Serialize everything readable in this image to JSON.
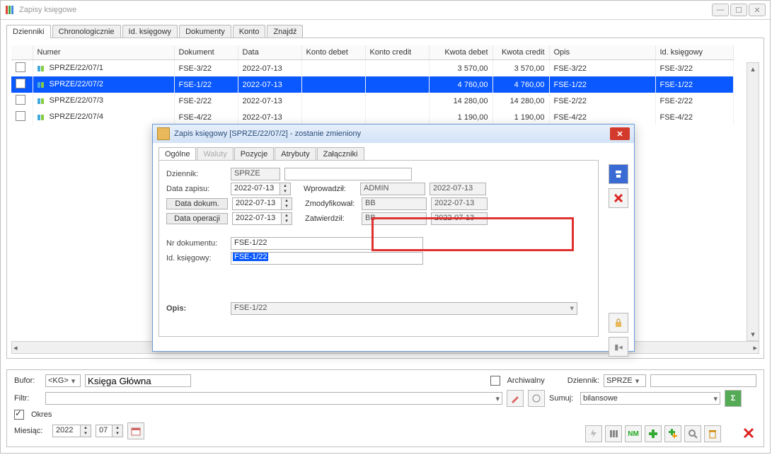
{
  "window": {
    "title": "Zapisy księgowe"
  },
  "tabs": [
    "Dzienniki",
    "Chronologicznie",
    "Id. księgowy",
    "Dokumenty",
    "Konto",
    "Znajdź"
  ],
  "grid": {
    "headers": [
      "Numer",
      "Dokument",
      "Data",
      "Konto debet",
      "Konto credit",
      "Kwota debet",
      "Kwota credit",
      "Opis",
      "Id. księgowy"
    ],
    "rows": [
      {
        "numer": "SPRZE/22/07/1",
        "dokument": "FSE-3/22",
        "data": "2022-07-13",
        "kdebet": "",
        "kcredit": "",
        "kwd": "3 570,00",
        "kwc": "3 570,00",
        "opis": "FSE-3/22",
        "idk": "FSE-3/22"
      },
      {
        "numer": "SPRZE/22/07/2",
        "dokument": "FSE-1/22",
        "data": "2022-07-13",
        "kdebet": "",
        "kcredit": "",
        "kwd": "4 760,00",
        "kwc": "4 760,00",
        "opis": "FSE-1/22",
        "idk": "FSE-1/22",
        "selected": true
      },
      {
        "numer": "SPRZE/22/07/3",
        "dokument": "FSE-2/22",
        "data": "2022-07-13",
        "kdebet": "",
        "kcredit": "",
        "kwd": "14 280,00",
        "kwc": "14 280,00",
        "opis": "FSE-2/22",
        "idk": "FSE-2/22"
      },
      {
        "numer": "SPRZE/22/07/4",
        "dokument": "FSE-4/22",
        "data": "2022-07-13",
        "kdebet": "",
        "kcredit": "",
        "kwd": "1 190,00",
        "kwc": "1 190,00",
        "opis": "FSE-4/22",
        "idk": "FSE-4/22"
      }
    ]
  },
  "bottom": {
    "bufor_label": "Bufor:",
    "bufor_value": "<KG>",
    "bufor_desc": "Księga Główna",
    "filtr_label": "Filtr:",
    "archiwalny_label": "Archiwalny",
    "dziennik_label": "Dziennik:",
    "dziennik_value": "SPRZE",
    "sumuj_label": "Sumuj:",
    "sumuj_value": "bilansowe",
    "okres_label": "Okres",
    "miesiac_label": "Miesiąc:",
    "rok_value": "2022",
    "mies_value": "07"
  },
  "dialog": {
    "title": "Zapis księgowy [SPRZE/22/07/2] - zostanie zmieniony",
    "tabs": [
      "Ogólne",
      "Waluty",
      "Pozycje",
      "Atrybuty",
      "Załączniki"
    ],
    "labels": {
      "dziennik": "Dziennik:",
      "data_zapisu": "Data zapisu:",
      "data_dokum": "Data dokum.",
      "data_operacji": "Data operacji",
      "wprowadzil": "Wprowadził:",
      "zmodyfikowal": "Zmodyfikował:",
      "zatwierdzil": "Zatwierdził:",
      "nr_dokumentu": "Nr dokumentu:",
      "id_ksiegowy": "Id. księgowy:",
      "opis": "Opis:"
    },
    "values": {
      "dziennik": "SPRZE",
      "data_zapisu": "2022-07-13",
      "data_dokum": "2022-07-13",
      "data_operacji": "2022-07-13",
      "wprowadzil": "ADMIN",
      "wprowadzil_date": "2022-07-13",
      "zmodyfikowal": "BB",
      "zmodyfikowal_date": "2022-07-13",
      "zatwierdzil": "BB",
      "zatwierdzil_date": "2022-07-13",
      "nr_dokumentu": "FSE-1/22",
      "id_ksiegowy": "FSE-1/22",
      "opis": "FSE-1/22"
    }
  }
}
